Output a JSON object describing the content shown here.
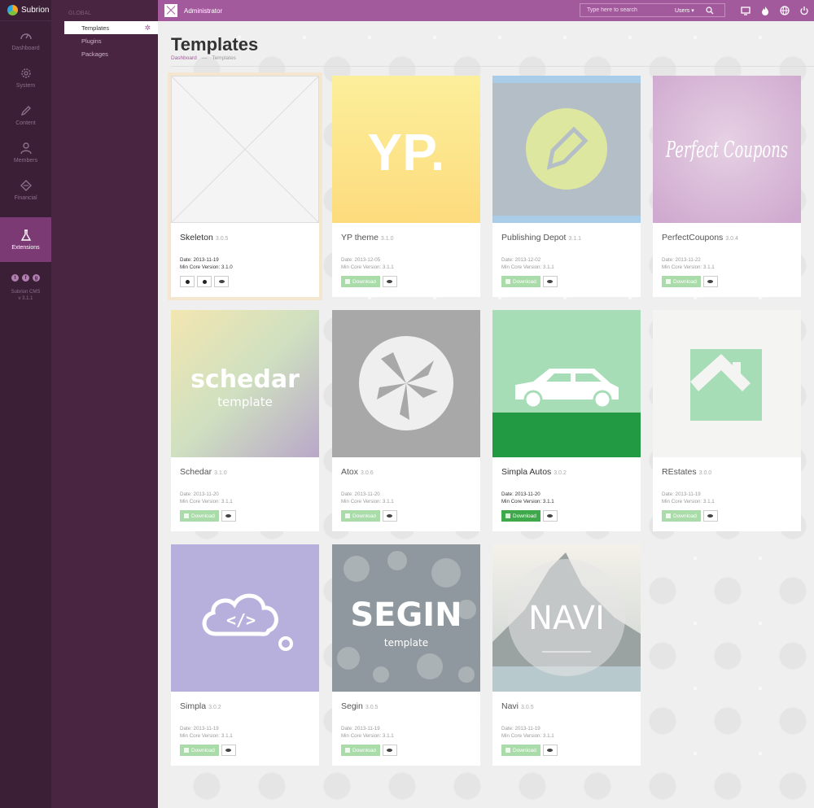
{
  "app": {
    "brand": "Subrion"
  },
  "rail": {
    "items": [
      {
        "label": "Dashboard",
        "icon": "speedometer-icon"
      },
      {
        "label": "System",
        "icon": "gear-icon"
      },
      {
        "label": "Content",
        "icon": "pencil-icon"
      },
      {
        "label": "Members",
        "icon": "user-icon"
      },
      {
        "label": "Financial",
        "icon": "tag-icon"
      },
      {
        "label": "Extensions",
        "icon": "flask-icon",
        "active": true
      }
    ],
    "socials": [
      "twitter-icon",
      "facebook-icon",
      "google-plus-icon"
    ],
    "version_line1": "Subrion CMS",
    "version_line2": "v 3.1.1"
  },
  "submenu": {
    "group": "GLOBAL",
    "items": [
      {
        "label": "Templates",
        "active": true
      },
      {
        "label": "Plugins"
      },
      {
        "label": "Packages"
      }
    ]
  },
  "topbar": {
    "user": "Administrator",
    "search_placeholder": "Type here to search",
    "search_scope": "Users ▾",
    "icons": [
      "monitor-icon",
      "fire-icon",
      "globe-icon",
      "power-icon"
    ]
  },
  "page": {
    "title": "Templates",
    "breadcrumb": [
      "Dashboard",
      "Templates"
    ],
    "breadcrumb_sep": "—"
  },
  "labels": {
    "download": "Download",
    "date_prefix": "Date:",
    "core_prefix": "Min Core Version:"
  },
  "templates": [
    {
      "name": "Skeleton",
      "version": "3.0.5",
      "date": "2013-11-19",
      "core": "3.1.0",
      "installed": true,
      "thumb_text": "",
      "accent": "#f4f4f4"
    },
    {
      "name": "YP theme",
      "version": "3.1.0",
      "date": "2013-12-05",
      "core": "3.1.1",
      "thumb_text": "YP.",
      "accent": "#fde27a"
    },
    {
      "name": "Publishing Depot",
      "version": "3.1.1",
      "date": "2013-12-02",
      "core": "3.1.1",
      "thumb_text": "",
      "accent": "#b4bec6"
    },
    {
      "name": "PerfectCoupons",
      "version": "3.0.4",
      "date": "2013-11-22",
      "core": "3.1.1",
      "thumb_text": "Perfect Coupons",
      "accent": "#d8bfdc"
    },
    {
      "name": "Schedar",
      "version": "3.1.0",
      "date": "2013-11-20",
      "core": "3.1.1",
      "thumb_text": "schedar",
      "thumb_sub": "template",
      "accent": "#d9d2bc"
    },
    {
      "name": "Atox",
      "version": "3.0.6",
      "date": "2013-11-20",
      "core": "3.1.1",
      "thumb_text": "",
      "accent": "#a8a8a8"
    },
    {
      "name": "Simpla Autos",
      "version": "3.0.2",
      "date": "2013-11-20",
      "core": "3.1.1",
      "thumb_text": "",
      "accent": "#a6dcb6",
      "highlight": true
    },
    {
      "name": "REstates",
      "version": "3.0.0",
      "date": "2013-11-19",
      "core": "3.1.1",
      "thumb_text": "",
      "accent": "#a6dcb6"
    },
    {
      "name": "Simpla",
      "version": "3.0.2",
      "date": "2013-11-19",
      "core": "3.1.1",
      "thumb_text": "",
      "accent": "#b7b0dd"
    },
    {
      "name": "Segin",
      "version": "3.0.5",
      "date": "2013-11-19",
      "core": "3.1.1",
      "thumb_text": "SEGIN",
      "thumb_sub": "template",
      "accent": "#9da6ab"
    },
    {
      "name": "Navi",
      "version": "3.0.5",
      "date": "2013-11-19",
      "core": "3.1.1",
      "thumb_text": "NAVI",
      "accent": "#b9c3bf"
    }
  ]
}
